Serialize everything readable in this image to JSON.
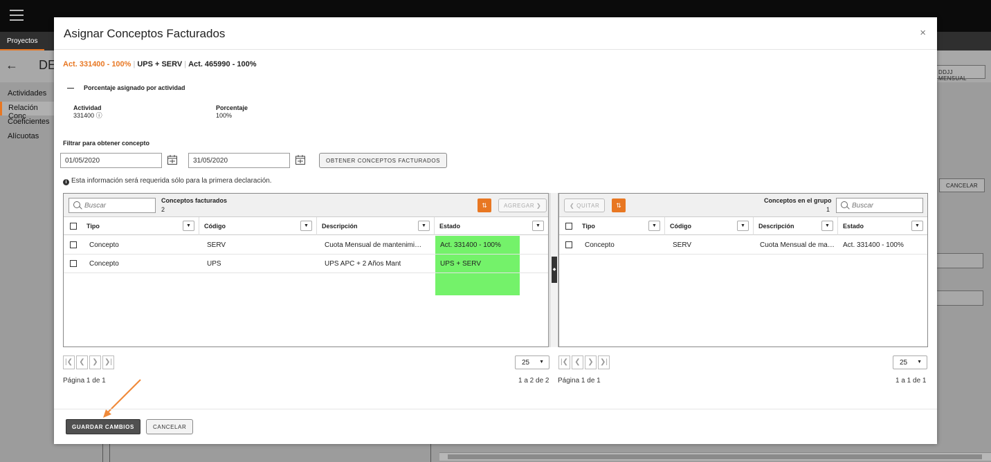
{
  "app": {
    "nav_tab": "Proyectos",
    "page_title": "DE",
    "back_icon": "←",
    "sidebar": [
      "Actividades",
      "Relación Conc",
      "Coeficientes",
      "Alícuotas"
    ],
    "header_button": "DDJJ MENSUAL",
    "cancel_button": "CANCELAR"
  },
  "modal": {
    "title": "Asignar Conceptos Facturados",
    "close_icon": "×",
    "summary": {
      "active": "Act. 331400 - 100%",
      "item2": "UPS + SERV",
      "item3": "Act. 465990 - 100%",
      "separator": "|"
    },
    "section": {
      "title": "Porcentaje asignado por actividad",
      "activity_label": "Actividad",
      "activity_value": "331400",
      "activity_info_icon": "ⓘ",
      "percent_label": "Porcentaje",
      "percent_value": "100%"
    },
    "filter": {
      "label": "Filtrar para obtener concepto",
      "date_from": "01/05/2020",
      "date_to": "31/05/2020",
      "obtain_button": "OBTENER CONCEPTOS FACTURADOS",
      "info_text": "Esta información será requerida sólo para la primera declaración."
    },
    "left_grid": {
      "search_placeholder": "Buscar",
      "title": "Conceptos facturados",
      "count": "2",
      "add_button": "AGREGAR ❯",
      "filter_icon": "⇅",
      "columns": [
        "Tipo",
        "Código",
        "Descripción",
        "Estado"
      ],
      "rows": [
        {
          "tipo": "Concepto",
          "codigo": "SERV",
          "descripcion": "Cuota Mensual de mantenimiento",
          "estado": "Act. 331400 - 100%"
        },
        {
          "tipo": "Concepto",
          "codigo": "UPS",
          "descripcion": "UPS APC + 2 Años Mant",
          "estado": "UPS + SERV"
        }
      ],
      "per_page": "25",
      "page_text": "Página 1 de 1",
      "range_text": "1 a 2 de 2"
    },
    "right_grid": {
      "remove_button": "❮ QUITAR",
      "filter_icon": "⇅",
      "title": "Conceptos en el grupo",
      "count": "1",
      "search_placeholder": "Buscar",
      "columns": [
        "Tipo",
        "Código",
        "Descripción",
        "Estado"
      ],
      "rows": [
        {
          "tipo": "Concepto",
          "codigo": "SERV",
          "descripcion": "Cuota Mensual de mantenimiento",
          "estado": "Act. 331400 - 100%"
        }
      ],
      "per_page": "25",
      "page_text": "Página 1 de 1",
      "range_text": "1 a 1 de 1"
    },
    "pager_icons": [
      "|❮",
      "❮",
      "❯",
      "❯|"
    ],
    "footer": {
      "save_button": "GUARDAR CAMBIOS",
      "cancel_button": "CANCELAR"
    }
  },
  "colors": {
    "accent": "#e87722",
    "highlight": "#74f26a"
  }
}
